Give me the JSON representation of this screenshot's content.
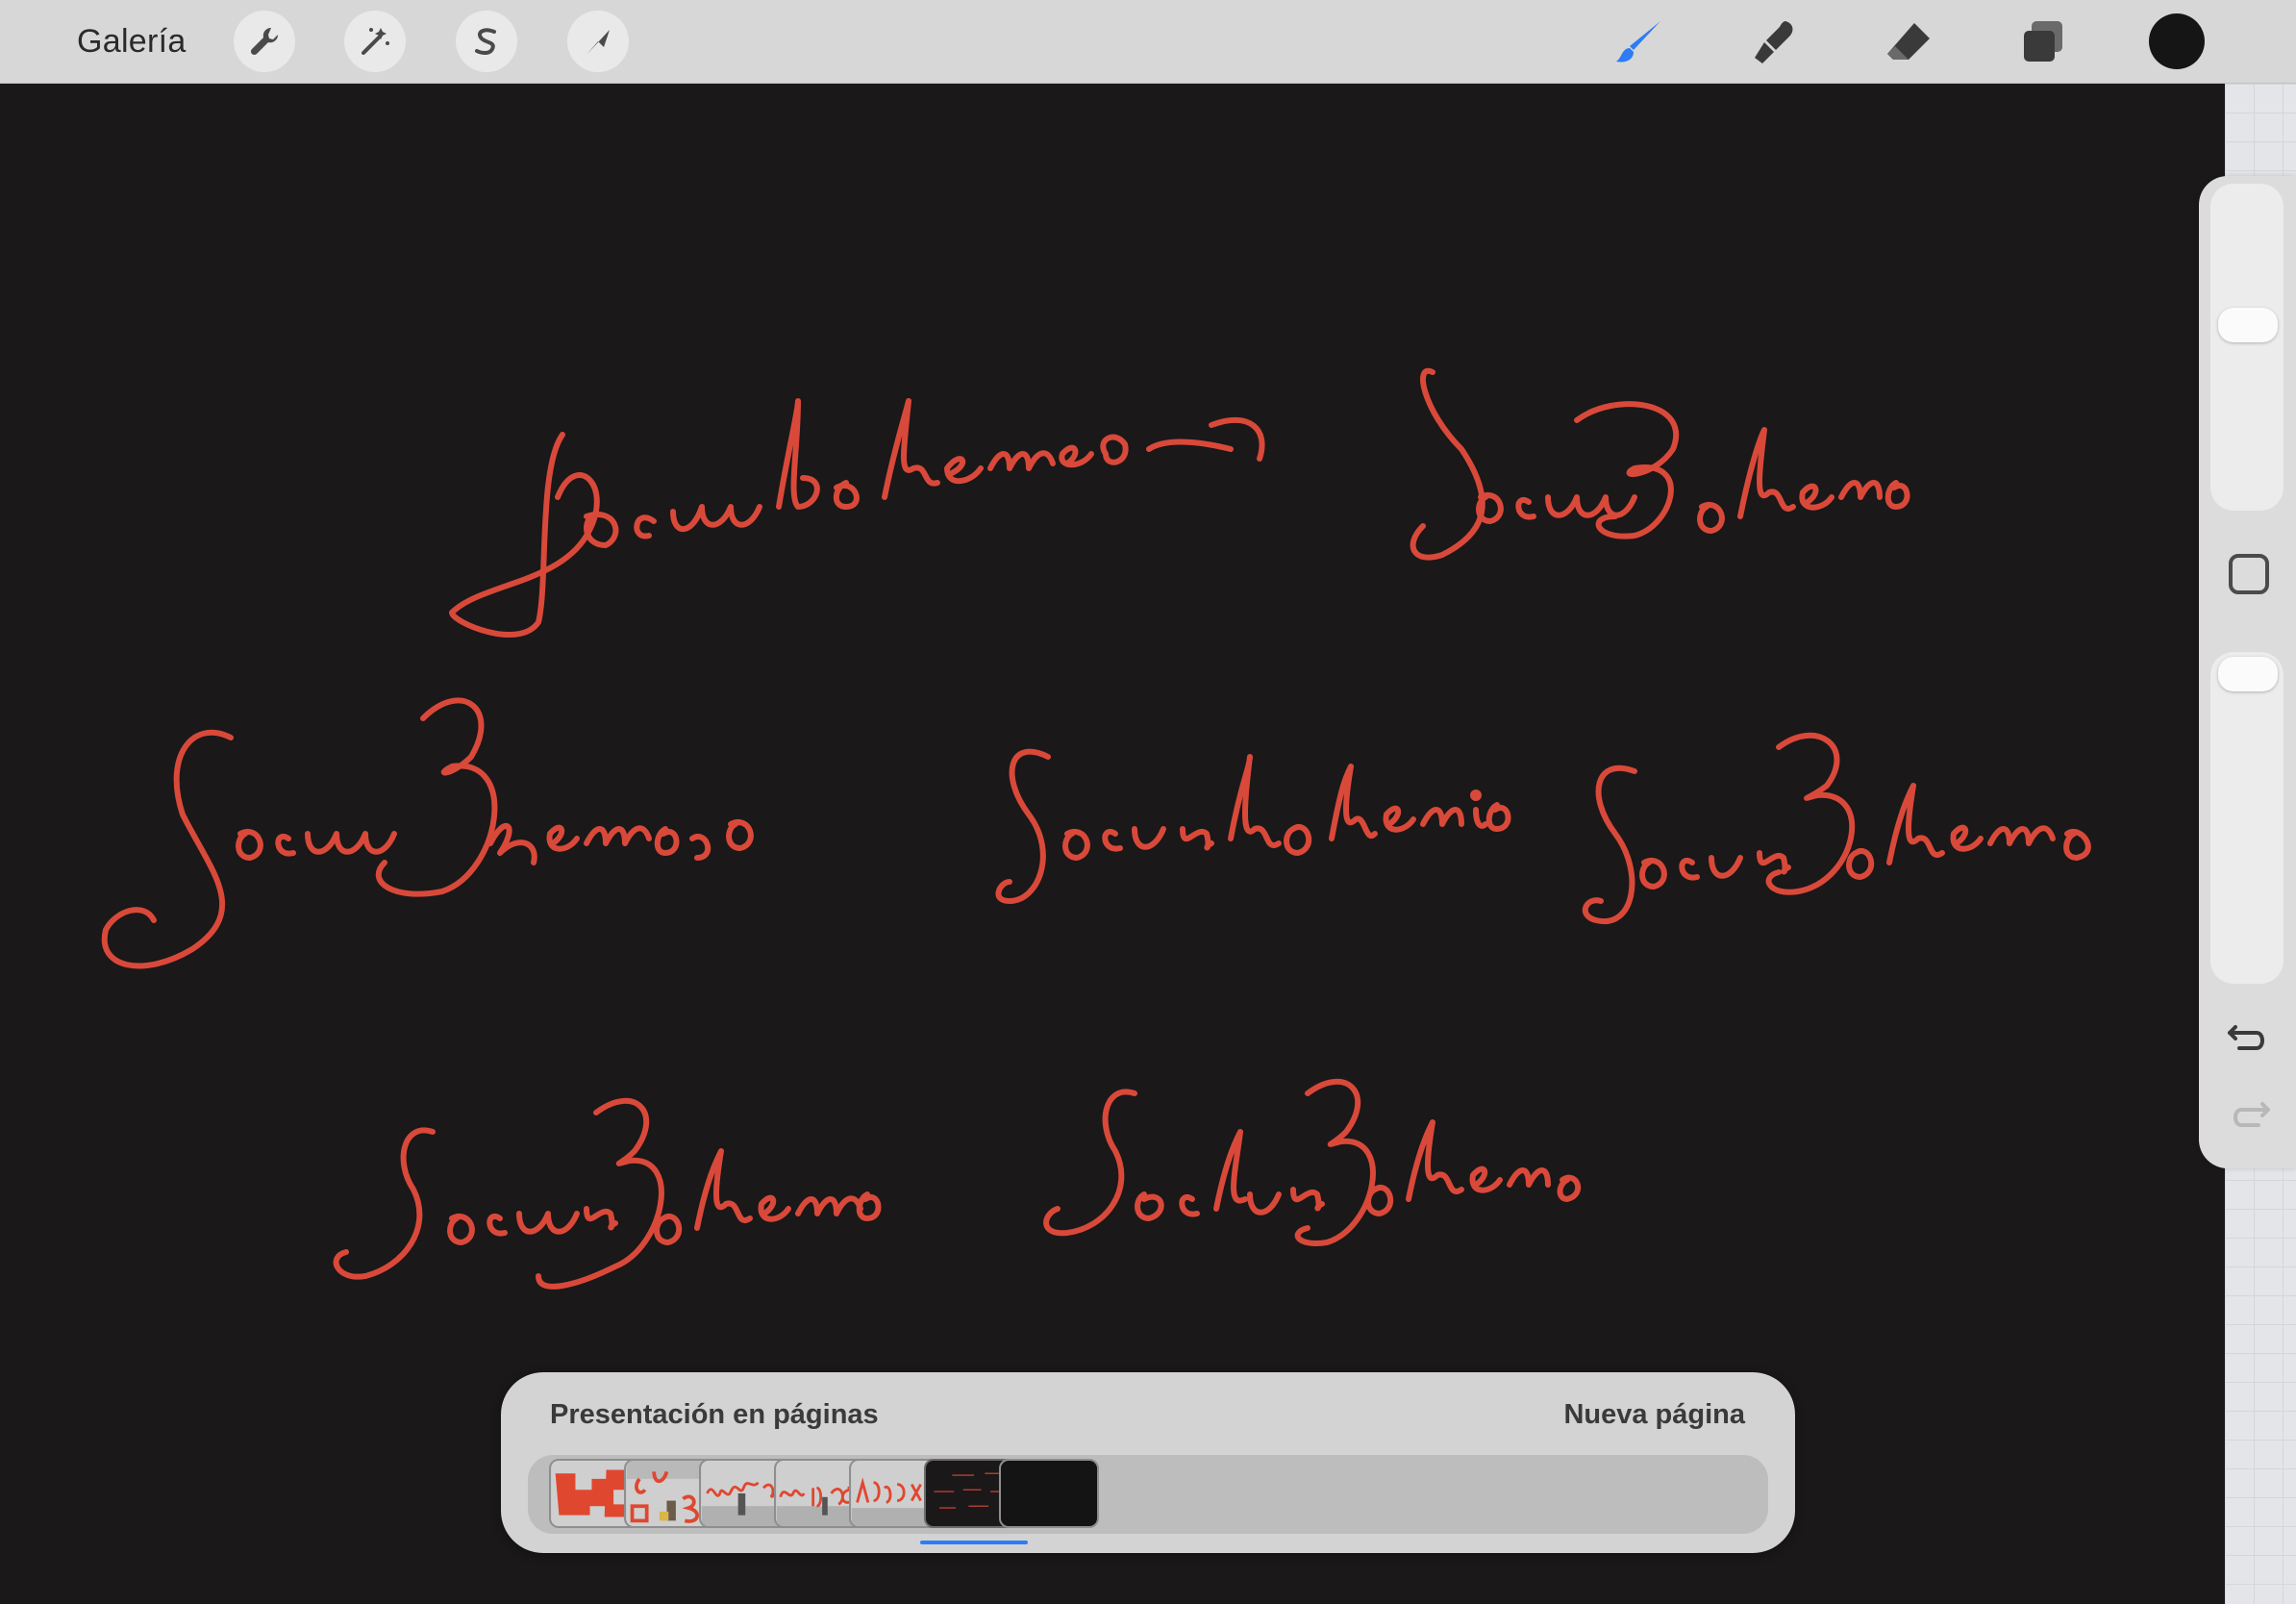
{
  "toolbar": {
    "gallery_label": "Galería",
    "left_tools": [
      {
        "name": "wrench-icon"
      },
      {
        "name": "magic-wand-icon"
      },
      {
        "name": "selection-s-icon"
      },
      {
        "name": "transform-arrow-icon"
      }
    ],
    "right_tools": [
      {
        "name": "brush-icon",
        "active": true
      },
      {
        "name": "smudge-icon"
      },
      {
        "name": "eraser-icon"
      },
      {
        "name": "layers-icon"
      }
    ],
    "current_color": "#151515",
    "active_color": "#2d7cf6"
  },
  "canvas": {
    "background": "#1a1819",
    "ink_color": "#d9493a",
    "signatures": [
      "Socunbohemio",
      "SocunBohemio",
      "SocunBohemio",
      "Socunbohemio",
      "SocunBohemio",
      "SocunBohemio",
      "SocunBohemio"
    ]
  },
  "sidebar": {
    "brush_size_icon": "size-slider",
    "modify_button": "square-icon",
    "opacity_icon": "opacity-slider",
    "undo_icon": "undo-icon",
    "redo_icon": "redo-icon"
  },
  "pages": {
    "title": "Presentación en páginas",
    "new_page_label": "Nueva página",
    "active_index": 5,
    "thumbnails": [
      {
        "name": "page-thumb-1"
      },
      {
        "name": "page-thumb-2"
      },
      {
        "name": "page-thumb-3"
      },
      {
        "name": "page-thumb-4"
      },
      {
        "name": "page-thumb-5"
      },
      {
        "name": "page-thumb-6"
      },
      {
        "name": "page-thumb-7"
      }
    ]
  }
}
